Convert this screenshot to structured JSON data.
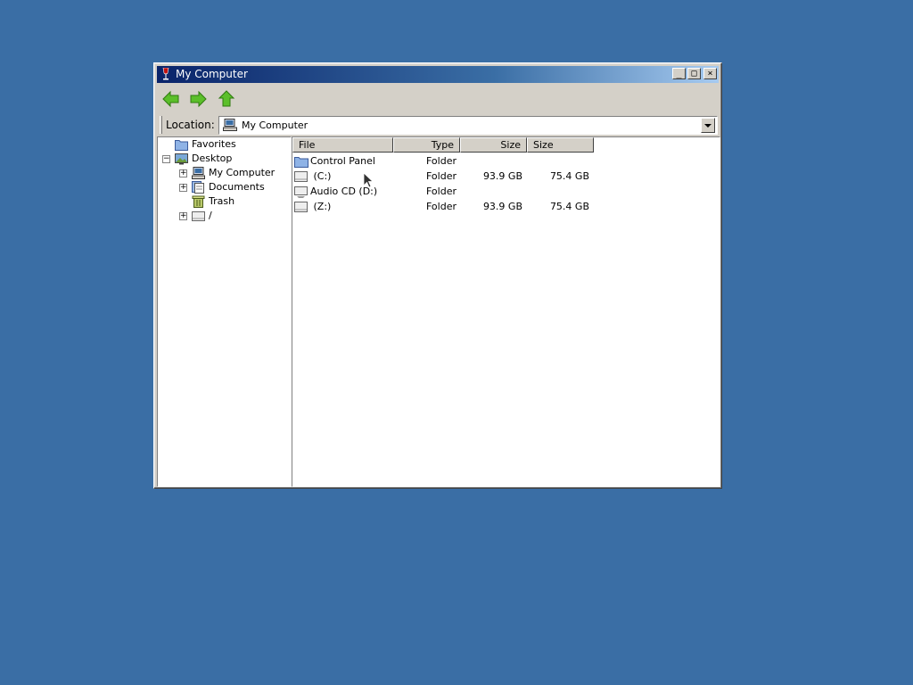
{
  "window": {
    "title": "My Computer",
    "controls": {
      "minimize": "_",
      "maximize": "□",
      "close": "×"
    }
  },
  "toolbar": {
    "back_icon": "back-arrow-icon",
    "forward_icon": "forward-arrow-icon",
    "up_icon": "up-arrow-icon"
  },
  "location": {
    "label": "Location:",
    "value": "My Computer",
    "icon": "computer-icon"
  },
  "tree": {
    "items": [
      {
        "label": "Favorites",
        "icon": "folder-icon"
      },
      {
        "label": "Desktop",
        "icon": "desktop-icon",
        "expander": "−"
      },
      {
        "label": "My Computer",
        "icon": "computer-icon",
        "expander": "+"
      },
      {
        "label": "Documents",
        "icon": "documents-icon",
        "expander": "+"
      },
      {
        "label": "Trash",
        "icon": "trash-icon"
      },
      {
        "label": "/",
        "icon": "drive-icon",
        "expander": "+"
      }
    ]
  },
  "list": {
    "columns": [
      "File",
      "Type",
      "Size",
      "Size avail..."
    ],
    "rows": [
      {
        "file": "Control Panel",
        "type": "Folder",
        "size": "",
        "avail": "",
        "icon": "folder-icon"
      },
      {
        "file": " (C:)",
        "type": "Folder",
        "size": "93.9 GB",
        "avail": "75.4 GB",
        "icon": "drive-icon"
      },
      {
        "file": "Audio CD (D:)",
        "type": "Folder",
        "size": "",
        "avail": "",
        "icon": "cd-drive-icon"
      },
      {
        "file": " (Z:)",
        "type": "Folder",
        "size": "93.9 GB",
        "avail": "75.4 GB",
        "icon": "drive-icon"
      }
    ]
  },
  "colors": {
    "desktop": "#3a6ea5",
    "title_start": "#0a246a",
    "title_end": "#a6caf0",
    "face": "#d4d0c8",
    "arrow_green": "#5bbf2a"
  }
}
